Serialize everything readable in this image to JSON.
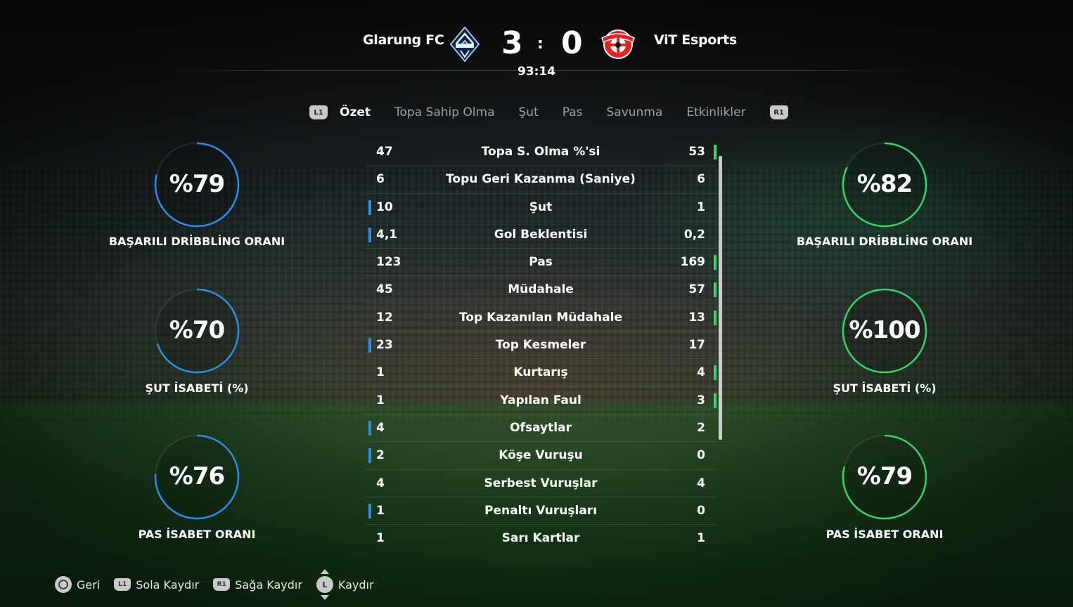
{
  "header": {
    "home_team": "Glarung FC",
    "away_team": "ViT Esports",
    "home_score": "3",
    "away_score": "0",
    "score_separator": ":",
    "clock": "93:14",
    "home_crest_icon": "whitecaps-crest-icon",
    "away_crest_icon": "leverkusen-crest-icon"
  },
  "tabs": {
    "left_shoulder": "L1",
    "right_shoulder": "R1",
    "items": [
      "Özet",
      "Topa Sahip Olma",
      "Şut",
      "Pas",
      "Savunma",
      "Etkinlikler"
    ],
    "active": "Özet"
  },
  "stats": [
    {
      "home": "47",
      "label": "Topa S. Olma %'si",
      "away": "53",
      "leader": "away"
    },
    {
      "home": "6",
      "label": "Topu Geri Kazanma (Saniye)",
      "away": "6",
      "leader": "none"
    },
    {
      "home": "10",
      "label": "Şut",
      "away": "1",
      "leader": "home"
    },
    {
      "home": "4,1",
      "label": "Gol Beklentisi",
      "away": "0,2",
      "leader": "home"
    },
    {
      "home": "123",
      "label": "Pas",
      "away": "169",
      "leader": "away"
    },
    {
      "home": "45",
      "label": "Müdahale",
      "away": "57",
      "leader": "away"
    },
    {
      "home": "12",
      "label": "Top Kazanılan Müdahale",
      "away": "13",
      "leader": "away"
    },
    {
      "home": "23",
      "label": "Top Kesmeler",
      "away": "17",
      "leader": "home"
    },
    {
      "home": "1",
      "label": "Kurtarış",
      "away": "4",
      "leader": "away"
    },
    {
      "home": "1",
      "label": "Yapılan Faul",
      "away": "3",
      "leader": "away"
    },
    {
      "home": "4",
      "label": "Ofsaytlar",
      "away": "2",
      "leader": "home"
    },
    {
      "home": "2",
      "label": "Köşe Vuruşu",
      "away": "0",
      "leader": "home"
    },
    {
      "home": "4",
      "label": "Serbest Vuruşlar",
      "away": "4",
      "leader": "none"
    },
    {
      "home": "1",
      "label": "Penaltı Vuruşları",
      "away": "0",
      "leader": "home"
    },
    {
      "home": "1",
      "label": "Sarı Kartlar",
      "away": "1",
      "leader": "none"
    }
  ],
  "home_rings": [
    {
      "value": "%79",
      "percent": 79,
      "label": "BAŞARILI DRİBBLİNG ORANI"
    },
    {
      "value": "%70",
      "percent": 70,
      "label": "ŞUT İSABETİ (%)"
    },
    {
      "value": "%76",
      "percent": 76,
      "label": "PAS İSABET ORANI"
    }
  ],
  "away_rings": [
    {
      "value": "%82",
      "percent": 82,
      "label": "BAŞARILI DRİBBLİNG ORANI"
    },
    {
      "value": "%100",
      "percent": 100,
      "label": "ŞUT İSABETİ (%)"
    },
    {
      "value": "%79",
      "percent": 79,
      "label": "PAS İSABET ORANI"
    }
  ],
  "colors": {
    "home_accent": "#2f8ee8",
    "away_accent": "#33d66a"
  },
  "footer": {
    "back_button": "Geri",
    "back_icon": "circle-button-icon",
    "l1_badge": "L1",
    "scroll_left": "Sola Kaydır",
    "r1_badge": "R1",
    "scroll_right": "Sağa Kaydır",
    "stick_badge": "L",
    "scroll": "Kaydır"
  }
}
